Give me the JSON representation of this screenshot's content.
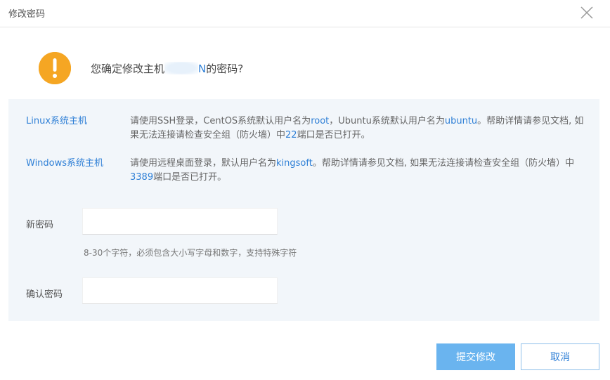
{
  "dialog": {
    "title": "修改密码",
    "close_icon": "close-icon"
  },
  "confirm": {
    "icon": "warning-icon",
    "prefix": "您确定修改主机",
    "host_suffix": "N",
    "suffix": "的密码?"
  },
  "info": {
    "linux": {
      "label": "Linux系统主机",
      "t1": "请使用SSH登录，CentOS系统默认用户名为",
      "user1": "root",
      "t2": "，Ubuntu系统默认用户名为",
      "user2": "ubuntu",
      "t3": "。帮助详情请参见文档, 如果无法连接请检查安全组（防火墙）中",
      "port": "22",
      "t4": "端口是否已打开。"
    },
    "windows": {
      "label": "Windows系统主机",
      "t1": "请使用远程桌面登录，默认用户名为",
      "user": "kingsoft",
      "t2": "。帮助详情请参见文档, 如果无法连接请检查安全组（防火墙）中",
      "port": "3389",
      "t3": "端口是否已打开。"
    }
  },
  "form": {
    "new_password": {
      "label": "新密码",
      "value": "",
      "placeholder": ""
    },
    "hint": "8-30个字符，必须包含大小写字母和数字，支持特殊字符",
    "confirm_password": {
      "label": "确认密码",
      "value": "",
      "placeholder": ""
    }
  },
  "buttons": {
    "submit": "提交修改",
    "cancel": "取消"
  },
  "colors": {
    "accent": "#2e7fd6",
    "warning": "#f5a623",
    "primary_button": "#6ab4ef",
    "panel_bg": "#f2f6fa"
  }
}
